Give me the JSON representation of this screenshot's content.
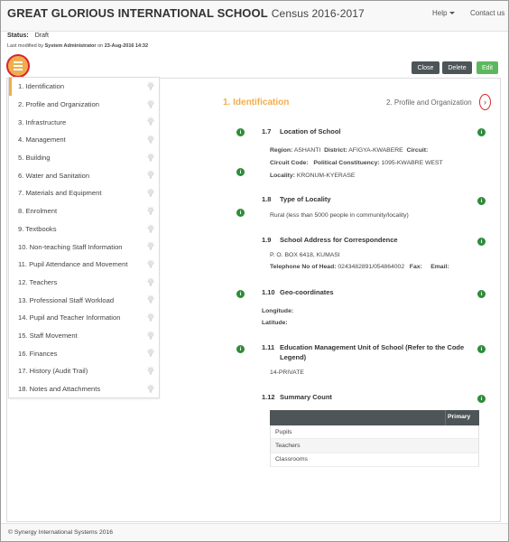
{
  "header": {
    "school_name": "GREAT GLORIOUS INTERNATIONAL SCHOOL",
    "census": "Census 2016-2017",
    "help_label": "Help",
    "contact_label": "Contact us"
  },
  "record": {
    "status_label": "Status:",
    "status_value": "Draft",
    "modified_prefix": "Last modified by",
    "modified_by": "System Administrator",
    "modified_on_label": "on",
    "modified_on": "23-Aug-2016 14:32"
  },
  "actions": {
    "close": "Close",
    "delete": "Delete",
    "edit": "Edit"
  },
  "sidebar": {
    "items": [
      {
        "label": "1. Identification"
      },
      {
        "label": "2. Profile and Organization"
      },
      {
        "label": "3. Infrastructure"
      },
      {
        "label": "4. Management"
      },
      {
        "label": "5. Building"
      },
      {
        "label": "6. Water and Sanitation"
      },
      {
        "label": "7. Materials and Equipment"
      },
      {
        "label": "8. Enrolment"
      },
      {
        "label": "9. Textbooks"
      },
      {
        "label": "10. Non-teaching Staff Information"
      },
      {
        "label": "11. Pupil Attendance and Movement"
      },
      {
        "label": "12. Teachers"
      },
      {
        "label": "13. Professional Staff Workload"
      },
      {
        "label": "14. Pupil and Teacher Information"
      },
      {
        "label": "15. Staff Movement"
      },
      {
        "label": "16. Finances"
      },
      {
        "label": "17. History (Audit Trail)"
      },
      {
        "label": "18. Notes and Attachments"
      }
    ]
  },
  "tabs": {
    "current": "1. Identification",
    "next": "2. Profile and Organization",
    "next_icon": "chevron-right-icon"
  },
  "sections": {
    "location": {
      "number": "1.7",
      "title": "Location of School",
      "region_label": "Region:",
      "region": "ASHANTI",
      "district_label": "District:",
      "district": "AFIGYA-KWABERE",
      "circuit_label": "Circuit:",
      "circuit_code_label": "Circuit Code:",
      "constituency_label": "Political Constituency:",
      "constituency": "1095-KWABRE WEST",
      "locality_label": "Locality:",
      "locality": "KRONUM-KYERASE"
    },
    "locality_type": {
      "number": "1.8",
      "title": "Type of Locality",
      "value": "Rural (less than 5000 people in community/locality)"
    },
    "address": {
      "number": "1.9",
      "title": "School Address for Correspondence",
      "value": "P. O. BOX 6418, KUMASI",
      "phone_label": "Telephone No of Head:",
      "phone": "0243482891/054864002",
      "fax_label": "Fax:",
      "email_label": "Email:"
    },
    "geo": {
      "number": "1.10",
      "title": "Geo-coordinates",
      "longitude_label": "Longitude:",
      "latitude_label": "Latitude:"
    },
    "emu": {
      "number": "1.11",
      "title_line1": "Education Management Unit of School (Refer to the Code",
      "title_line2": "Legend)",
      "value": "14-PRIVATE"
    },
    "summary": {
      "number": "1.12",
      "title": "Summary Count",
      "column": "Primary",
      "rows": [
        "Pupils",
        "Teachers",
        "Classrooms"
      ]
    }
  },
  "footer": {
    "copyright": "© Synergy International Systems 2016"
  },
  "colors": {
    "accent": "#f0ad4e",
    "info": "#2e8b3a",
    "dark_button": "#4e5558",
    "edit_button": "#5cb85c",
    "highlight_ring": "#d9262c"
  }
}
